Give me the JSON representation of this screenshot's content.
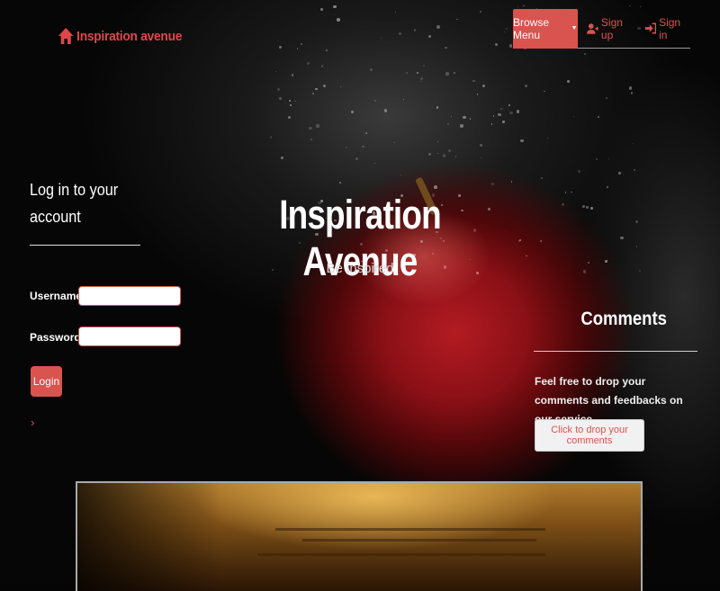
{
  "brand": {
    "name": "Inspiration avenue",
    "icon": "home-icon"
  },
  "nav": {
    "browse_label": "Browse Menu",
    "signup_label": "Sign up",
    "signin_label": "Sign in",
    "accent": "#d9534f"
  },
  "login": {
    "title": "Log in to your account",
    "username_label": "Username",
    "password_label": "Password",
    "username_value": "",
    "password_value": "",
    "button_label": "Login",
    "chevron": "›"
  },
  "hero": {
    "title": "Inspiration Avenue",
    "subtitle": "Be inspired"
  },
  "comments": {
    "title": "Comments",
    "text": "Feel free to drop your comments and feedbacks on our service",
    "button_label": "Click to drop your comments"
  }
}
